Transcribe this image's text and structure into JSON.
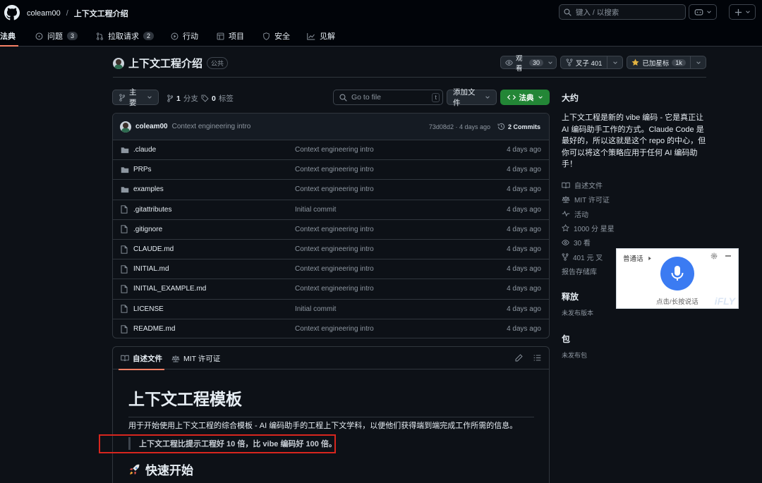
{
  "header": {
    "owner": "coleam00",
    "separator": "/",
    "repo": "上下文工程介绍",
    "search_placeholder": "键入 / 以搜索",
    "search_key": "/"
  },
  "nav": {
    "tabs": [
      {
        "label": "法典",
        "count": null
      },
      {
        "label": "问题",
        "count": "3"
      },
      {
        "label": "拉取请求",
        "count": "2"
      },
      {
        "label": "行动",
        "count": null
      },
      {
        "label": "项目",
        "count": null
      },
      {
        "label": "安全",
        "count": null
      },
      {
        "label": "见解",
        "count": null
      }
    ]
  },
  "repo": {
    "title": "上下文工程介绍",
    "visibility": "公共",
    "watch_label": "观看",
    "watch_count": "30",
    "fork_label": "叉子 401",
    "star_label": "已加星标",
    "star_count": "1k"
  },
  "branch": {
    "name": "主要",
    "branches_count": "1",
    "branches_label": "分支",
    "tags_count": "0",
    "tags_label": "标签",
    "goto_placeholder": "Go to file",
    "goto_key": "t",
    "add_file": "添加文件",
    "code_label": "法典"
  },
  "commit": {
    "user": "coleam00",
    "message": "Context engineering intro",
    "hash_time": "73d08d2 · 4 days ago",
    "commits": "2 Commits"
  },
  "files": [
    {
      "type": "folder",
      "name": ".claude",
      "message": "Context engineering intro",
      "date": "4 days ago"
    },
    {
      "type": "folder",
      "name": "PRPs",
      "message": "Context engineering intro",
      "date": "4 days ago"
    },
    {
      "type": "folder",
      "name": "examples",
      "message": "Context engineering intro",
      "date": "4 days ago"
    },
    {
      "type": "file",
      "name": ".gitattributes",
      "message": "Initial commit",
      "date": "4 days ago"
    },
    {
      "type": "file",
      "name": ".gitignore",
      "message": "Context engineering intro",
      "date": "4 days ago"
    },
    {
      "type": "file",
      "name": "CLAUDE.md",
      "message": "Context engineering intro",
      "date": "4 days ago"
    },
    {
      "type": "file",
      "name": "INITIAL.md",
      "message": "Context engineering intro",
      "date": "4 days ago"
    },
    {
      "type": "file",
      "name": "INITIAL_EXAMPLE.md",
      "message": "Context engineering intro",
      "date": "4 days ago"
    },
    {
      "type": "file",
      "name": "LICENSE",
      "message": "Initial commit",
      "date": "4 days ago"
    },
    {
      "type": "file",
      "name": "README.md",
      "message": "Context engineering intro",
      "date": "4 days ago"
    }
  ],
  "readme": {
    "tab_readme": "自述文件",
    "tab_license": "MIT 许可证",
    "h1": "上下文工程模板",
    "intro": "用于开始使用上下文工程的综合模板 - AI 编码助手的工程上下文学科，以便他们获得端到端完成工作所需的信息。",
    "quote": "上下文工程比提示工程好 10 倍，比 vibe 编码好 100 倍。",
    "h2": "快速开始"
  },
  "sidebar": {
    "about_title": "大约",
    "about_text": "上下文工程是新的 vibe 编码 - 它是真正让 AI 编码助手工作的方式。Claude Code 是最好的，所以这就是这个 repo 的中心，但你可以将这个策略应用于任何 AI 编码助手！",
    "items": [
      {
        "icon": "book-icon",
        "label": "自述文件"
      },
      {
        "icon": "scale-icon",
        "label": "MIT 许可证"
      },
      {
        "icon": "pulse-icon",
        "label": "活动"
      },
      {
        "icon": "star-icon",
        "label": "1000 分 星星"
      },
      {
        "icon": "eye-icon",
        "label": "30 看"
      },
      {
        "icon": "fork-icon",
        "label": "401 元 叉"
      }
    ],
    "report": "报告存储库",
    "releases_title": "释放",
    "releases_sub": "未发布版本",
    "packages_title": "包",
    "packages_sub": "未发布包"
  },
  "voice_widget": {
    "mode": "普通话",
    "hint": "点击/长按说话",
    "brand": "iFLY"
  }
}
